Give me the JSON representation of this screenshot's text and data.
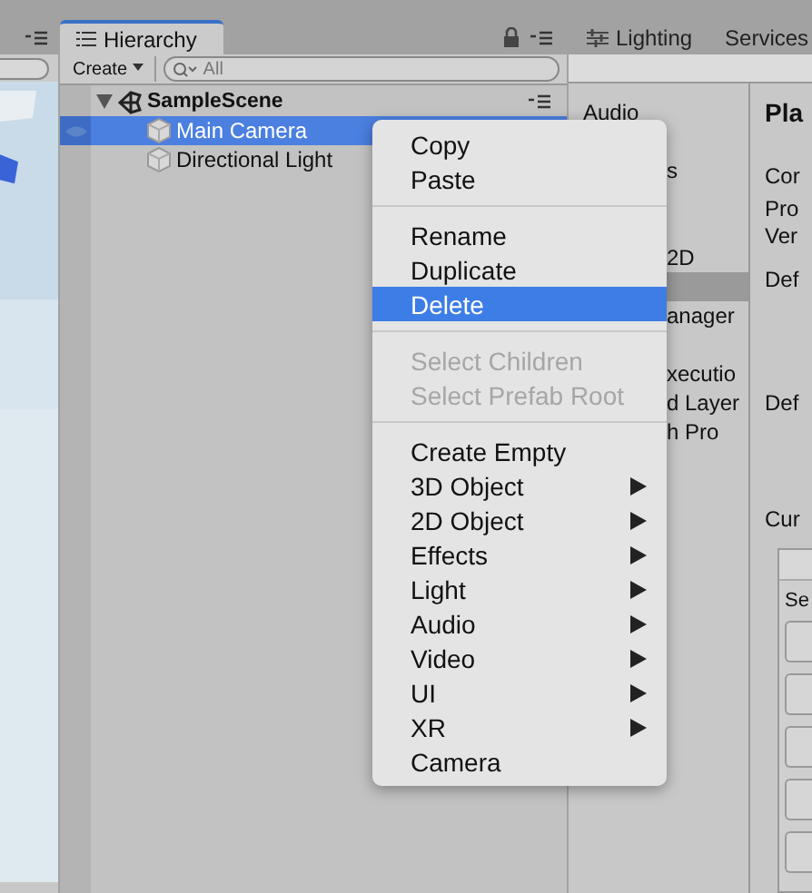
{
  "hierarchy": {
    "tab": "Hierarchy",
    "create_button": "Create",
    "search_placeholder": "All",
    "scene": {
      "name": "SampleScene",
      "expanded": true,
      "children": [
        {
          "name": "Main Camera",
          "selected": true
        },
        {
          "name": "Directional Light",
          "selected": false
        }
      ]
    }
  },
  "right_tabs": [
    "Lighting",
    "Services"
  ],
  "settings_sidebar": [
    {
      "label": "Audio",
      "selected": false
    },
    {
      "label": "s",
      "selected": false
    },
    {
      "label": "2D",
      "selected": false
    },
    {
      "selected": true
    },
    {
      "label": "anager",
      "selected": false
    },
    {
      "label": "xecutio",
      "selected": false
    },
    {
      "label": "d Layer",
      "selected": false
    },
    {
      "label": "h Pro",
      "selected": false
    }
  ],
  "inspector": {
    "title": "Pla",
    "labels": [
      "Cor",
      "Pro",
      "Ver",
      "Def",
      "Def",
      "Cur"
    ],
    "box_label": "Se"
  },
  "context_menu": [
    {
      "kind": "item",
      "label": "Copy",
      "disabled": false,
      "selected": false,
      "submenu": false
    },
    {
      "kind": "item",
      "label": "Paste",
      "disabled": false,
      "selected": false,
      "submenu": false
    },
    {
      "kind": "separator"
    },
    {
      "kind": "item",
      "label": "Rename",
      "disabled": false,
      "selected": false,
      "submenu": false
    },
    {
      "kind": "item",
      "label": "Duplicate",
      "disabled": false,
      "selected": false,
      "submenu": false
    },
    {
      "kind": "item",
      "label": "Delete",
      "disabled": false,
      "selected": true,
      "submenu": false
    },
    {
      "kind": "separator"
    },
    {
      "kind": "item",
      "label": "Select Children",
      "disabled": true,
      "selected": false,
      "submenu": false
    },
    {
      "kind": "item",
      "label": "Select Prefab Root",
      "disabled": true,
      "selected": false,
      "submenu": false
    },
    {
      "kind": "separator"
    },
    {
      "kind": "item",
      "label": "Create Empty",
      "disabled": false,
      "selected": false,
      "submenu": false
    },
    {
      "kind": "item",
      "label": "3D Object",
      "disabled": false,
      "selected": false,
      "submenu": true
    },
    {
      "kind": "item",
      "label": "2D Object",
      "disabled": false,
      "selected": false,
      "submenu": true
    },
    {
      "kind": "item",
      "label": "Effects",
      "disabled": false,
      "selected": false,
      "submenu": true
    },
    {
      "kind": "item",
      "label": "Light",
      "disabled": false,
      "selected": false,
      "submenu": true
    },
    {
      "kind": "item",
      "label": "Audio",
      "disabled": false,
      "selected": false,
      "submenu": true
    },
    {
      "kind": "item",
      "label": "Video",
      "disabled": false,
      "selected": false,
      "submenu": true
    },
    {
      "kind": "item",
      "label": "UI",
      "disabled": false,
      "selected": false,
      "submenu": true
    },
    {
      "kind": "item",
      "label": "XR",
      "disabled": false,
      "selected": false,
      "submenu": true
    },
    {
      "kind": "item",
      "label": "Camera",
      "disabled": false,
      "selected": false,
      "submenu": false
    }
  ]
}
